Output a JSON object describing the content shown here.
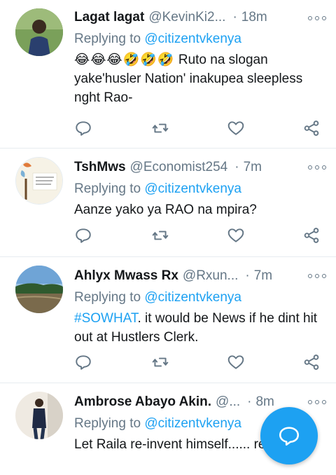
{
  "colors": {
    "accent": "#1da1f2",
    "text": "#14171a",
    "muted": "#657786",
    "divider": "#e6ecf0"
  },
  "replying_prefix": "Replying to",
  "tweets": [
    {
      "name": "Lagat lagat",
      "handle": "@KevinKi2...",
      "time_sep": "·",
      "time": "18m",
      "reply_to": "@citizentvkenya",
      "emojis": "😂😂😂🤣🤣🤣",
      "text": "Ruto na slogan yake'husler Nation' inakupea sleepless nght Rao-"
    },
    {
      "name": "TshMws",
      "handle": "@Economist254",
      "time_sep": "·",
      "time": "7m",
      "reply_to": "@citizentvkenya",
      "text": "Aanze yako ya RAO na mpira?"
    },
    {
      "name": "Ahlyx Mwass Rx",
      "handle": "@Rxun...",
      "time_sep": "·",
      "time": "7m",
      "reply_to": "@citizentvkenya",
      "hashtag": "#SOWHAT",
      "text": ". it would be News if he dint hit out at Hustlers Clerk."
    },
    {
      "name": "Ambrose Abayo Akin.",
      "handle": "@...",
      "time_sep": "·",
      "time": "8m",
      "reply_to": "@citizentvkenya",
      "text": "Let Raila re-invent himself......  real"
    }
  ],
  "icons": {
    "reply": "reply-icon",
    "retweet": "retweet-icon",
    "like": "heart-icon",
    "share": "share-icon",
    "more": "more-options-icon",
    "compose": "compose-reply-icon"
  }
}
